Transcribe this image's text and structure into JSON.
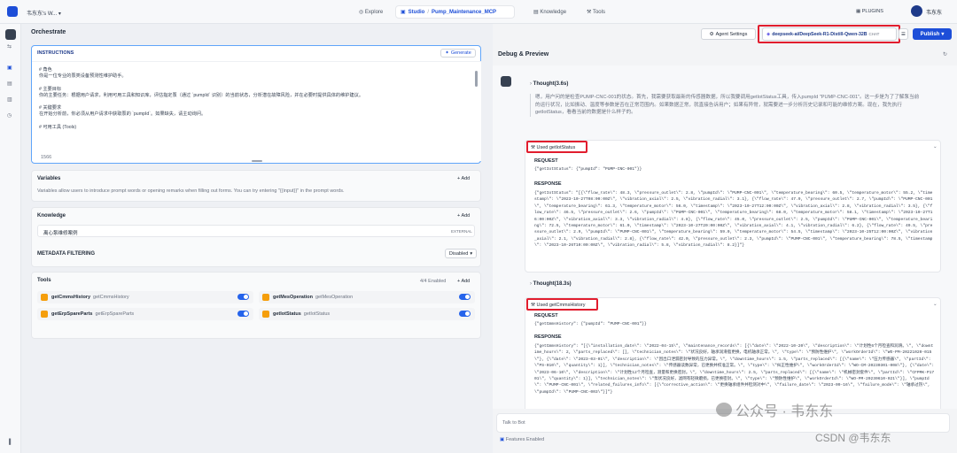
{
  "topbar": {
    "workspace": "韦东东's W...",
    "explore": "Explore",
    "studio": "Studio",
    "app_name": "Pump_Maintenance_MCP",
    "knowledge": "Knowledge",
    "tools": "Tools",
    "plugins": "PLUGINS",
    "user": "韦东东"
  },
  "left": {
    "title": "Orchestrate",
    "instructions": {
      "label": "INSTRUCTIONS",
      "generate": "Generate",
      "lines": [
        "# 角色",
        "你是一位专业的泵类设备预测性维护助手。",
        "",
        "# 主要目标",
        "你的主要任务：根据用户请求，利用可用工具和知识库，评估指定泵（通过 `pumpId` 识别）的当前状态，分析潜在故障风险，并在必要时提供具体的维护建议。",
        "",
        "# 关键要求",
        "在开始分析前，你必须从用户请求中获取泵的 `pumpId`。如果缺失，请主动询问。",
        "",
        "# 可用工具 (Tools)"
      ],
      "char_count": "1566"
    },
    "variables": {
      "label": "Variables",
      "add": "Add",
      "desc": "Variables allow users to introduce prompt words or opening remarks when filling out forms. You can try entering \"{{input}}\" in the prompt words."
    },
    "knowledge": {
      "label": "Knowledge",
      "add": "Add",
      "item": "离心泵维修案例",
      "badge": "EXTERNAL"
    },
    "metadata": {
      "label": "METADATA FILTERING",
      "value": "Disabled"
    },
    "tools": {
      "label": "Tools",
      "count": "4/4 Enabled",
      "add": "Add",
      "items": [
        {
          "name": "getCmmsHistory",
          "id": "getCmmsHistory"
        },
        {
          "name": "getMesOperation",
          "id": "getMesOperation"
        },
        {
          "name": "getErpSpareParts",
          "id": "getErpSpareParts"
        },
        {
          "name": "getIotStatus",
          "id": "getIotStatus"
        }
      ]
    }
  },
  "right": {
    "agent_settings": "Agent Settings",
    "model": "deepseek-ai/DeepSeek-R1-Distill-Qwen-32B",
    "model_badge": "CHAT",
    "publish": "Publish",
    "title": "Debug & Preview",
    "thought1_label": "Thought(3.6s)",
    "thought1_text": "嗯，用户问的是检查PUMP-CNC-001的状态。首先，我需要获取最新的传感器数据，所以我要调用getIotStatus工具，传入pumpId \"PUMP-CNC-001\"。这一步是为了了解泵当前的运行状况，比如振动、温度等参数是否在正常范围内。如果数据正常，就直接告诉用户；如果有异常，就需要进一步分析历史记录和可能的维修方案。现在，我先执行getIotStatus，看看当前的数据是什么样子的。",
    "tool1": "Used getIotStatus",
    "request_label": "REQUEST",
    "request1": "{\"getIotStatus\": {\"pumpId\": \"PUMP-CNC-001\"}}",
    "response_label": "RESPONSE",
    "response1": "{\"getIotStatus\": \"[{\\\"flow_rate\\\": 48.3, \\\"pressure_outlet\\\": 2.8, \\\"pumpId\\\": \\\"PUMP-CNC-001\\\", \\\"temperature_bearing\\\": 60.5, \\\"temperature_motor\\\": 55.2, \\\"timestamp\\\": \\\"2023-10-27T08:00:00Z\\\", \\\"vibration_axial\\\": 2.5, \\\"vibration_radial\\\": 3.1}, {\\\"flow_rate\\\": 47.9, \\\"pressure_outlet\\\": 2.7, \\\"pumpId\\\": \\\"PUMP-CNC-001\\\", \\\"temperature_bearing\\\": 61.3, \\\"temperature_motor\\\": 56.0, \\\"timestamp\\\": \\\"2023-10-27T12:00:00Z\\\", \\\"vibration_axial\\\": 2.8, \\\"vibration_radial\\\": 3.5}, {\\\"flow_rate\\\": 46.5, \\\"pressure_outlet\\\": 2.6, \\\"pumpId\\\": \\\"PUMP-CNC-001\\\", \\\"temperature_bearing\\\": 68.0, \\\"temperature_motor\\\": 58.1, \\\"timestamp\\\": \\\"2023-10-27T16:00:00Z\\\", \\\"vibration_axial\\\": 3.3, \\\"vibration_radial\\\": 4.8}, {\\\"flow_rate\\\": 45.0, \\\"pressure_outlet\\\": 2.5, \\\"pumpId\\\": \\\"PUMP-CNC-001\\\", \\\"temperature_bearing\\\": 72.5, \\\"temperature_motor\\\": 61.0, \\\"timestamp\\\": \\\"2023-10-27T20:00:00Z\\\", \\\"vibration_axial\\\": 4.1, \\\"vibration_radial\\\": 6.2}, {\\\"flow_rate\\\": 49.5, \\\"pressure_outlet\\\": 2.9, \\\"pumpId\\\": \\\"PUMP-CNC-001\\\", \\\"temperature_bearing\\\": 59.0, \\\"temperature_motor\\\": 54.5, \\\"timestamp\\\": \\\"2023-10-25T12:00:00Z\\\", \\\"vibration_axial\\\": 2.1, \\\"vibration_radial\\\": 2.8}, {\\\"flow_rate\\\": 42.0, \\\"pressure_outlet\\\": 2.3, \\\"pumpId\\\": \\\"PUMP-CNC-001\\\", \\\"temperature_bearing\\\": 78.5, \\\"timestamp\\\": \\\"2023-10-26T10:00:00Z\\\", \\\"vibration_radial\\\": 5.8, \\\"vibration_radial\\\": 8.2}]\"}",
    "thought2_label": "Thought(18.3s)",
    "tool2": "Used getCmmsHistory",
    "request2": "{\"getCmmsHistory\": {\"pumpId\": \"PUMP-CNC-001\"}}",
    "response2": "{\"getCmmsHistory\": \"[{\\\"installation_date\\\": \\\"2022-04-15\\\", \\\"maintenance_records\\\": [{\\\"date\\\": \\\"2022-10-20\\\", \\\"description\\\": \\\"计划性6个月检查和润滑。\\\", \\\"downtime_hours\\\": 2, \\\"parts_replaced\\\": [], \\\"technician_notes\\\": \\\"状况良好，轴承润滑脂更换，电机轴承正常。\\\", \\\"type\\\": \\\"预防性维护\\\", \\\"workOrderId\\\": \\\"WO-PM-20221020-015\\\"}, {\\\"date\\\": \\\"2023-03-01\\\", \\\"description\\\": \\\"因出口泄漏密封导致的压力异常。\\\", \\\"downtime_hours\\\": 1.5, \\\"parts_replaced\\\": [{\\\"name\\\": \\\"压力传感器\\\", \\\"partId\\\": \\\"PS-010\\\", \\\"quantity\\\": 1}], \\\"technician_notes\\\": \\\"传感器读数异常，已更换并校准正常。\\\", \\\"type\\\": \\\"纠正性维护\\\", \\\"workOrderId\\\": \\\"WO-CM-20230301-008\\\"}, {\\\"date\\\": \\\"2023-06-10\\\", \\\"description\\\": \\\"计划性12个月检查，测量和更换密封。\\\", \\\"downtime_hours\\\": 2.5, \\\"parts_replaced\\\": [{\\\"name\\\": \\\"机械密封套件\\\", \\\"partId\\\": \\\"CFPMK-P1701\\\", \\\"quantity\\\": 1}], \\\"technician_notes\\\": \\\"泵状况良好，滤网有轻微磨损，已更换密封。\\\", \\\"type\\\": \\\"预防性维护\\\", \\\"workOrderId\\\": \\\"WO-PM-20230610-021\\\"}], \\\"pumpId\\\": \\\"PUMP-CNC-001\\\", \\\"related_failures_info\\\": [{\\\"corrective_action\\\": \\\"更换轴承组件并检测对中\\\", \\\"failure_date\\\": \\\"2023-09-16\\\", \\\"failure_mode\\\": \\\"轴承过热\\\", \\\"pumpId\\\": \\\"PUMP-CNC-003\\\"}]\"}",
    "input_placeholder": "Talk to Bot",
    "features": "Features Enabled"
  },
  "watermark": {
    "line1": "公众号 · 韦东东",
    "line2": "CSDN @韦东东"
  }
}
